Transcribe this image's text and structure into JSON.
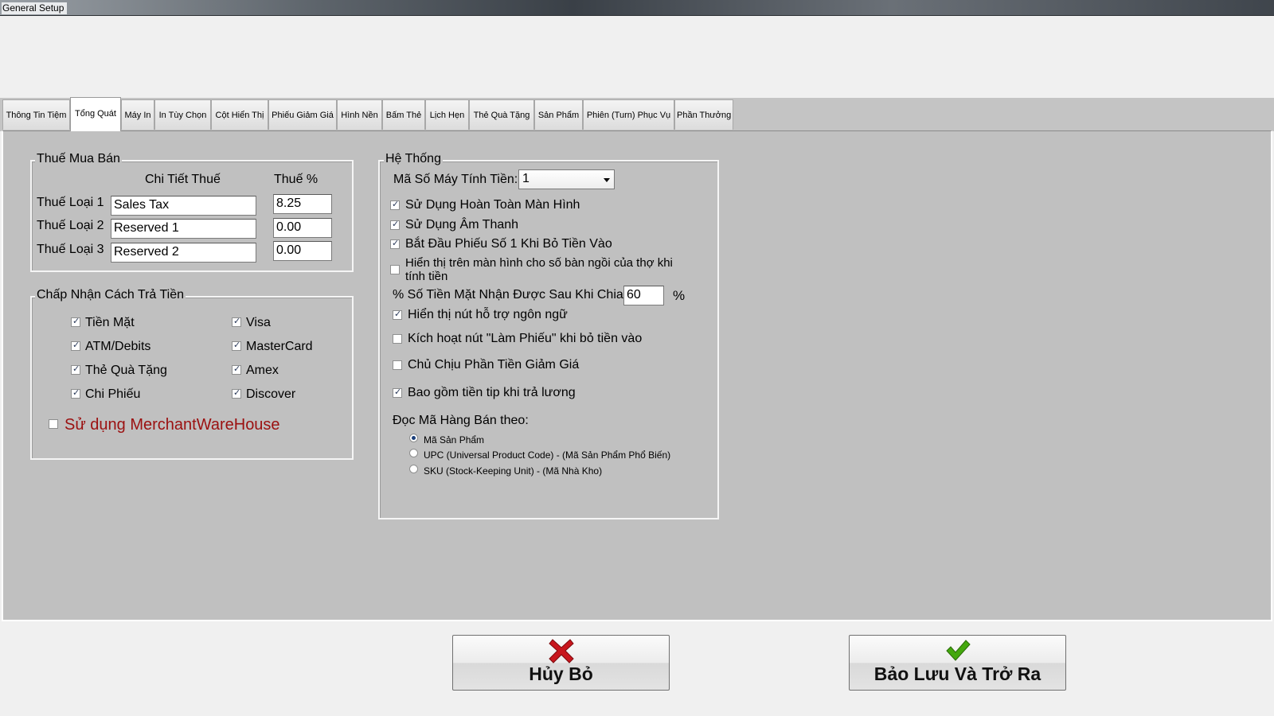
{
  "window": {
    "title": "General Setup"
  },
  "tabs": [
    {
      "label": "Thông Tin Tiệm"
    },
    {
      "label": "Tổng Quát"
    },
    {
      "label": "Máy In"
    },
    {
      "label": "In Tùy Chọn"
    },
    {
      "label": "Cột Hiển Thị"
    },
    {
      "label": "Phiếu Giảm Giá"
    },
    {
      "label": "Hình Nền"
    },
    {
      "label": "Bấm Thẻ"
    },
    {
      "label": "Lịch Hẹn"
    },
    {
      "label": "Thẻ Quà Tặng"
    },
    {
      "label": "Sản Phẩm"
    },
    {
      "label": "Phiên (Turn) Phục Vụ"
    },
    {
      "label": "Phần Thưởng"
    }
  ],
  "active_tab": "Tổng Quát",
  "tax": {
    "legend": "Thuế Mua Bán",
    "col_detail": "Chi Tiết Thuế",
    "col_rate": "Thuế %",
    "rows": [
      {
        "label": "Thuế Loại 1",
        "detail": "Sales Tax",
        "rate": "8.25"
      },
      {
        "label": "Thuế Loại 2",
        "detail": "Reserved 1",
        "rate": "0.00"
      },
      {
        "label": "Thuế Loại 3",
        "detail": "Reserved 2",
        "rate": "0.00"
      }
    ]
  },
  "payment": {
    "legend": "Chấp Nhận Cách Trả Tiền",
    "left": [
      {
        "label": "Tiền Mặt",
        "checked": true
      },
      {
        "label": "ATM/Debits",
        "checked": true
      },
      {
        "label": "Thẻ Quà Tặng",
        "checked": true
      },
      {
        "label": "Chi Phiếu",
        "checked": true
      }
    ],
    "right": [
      {
        "label": "Visa",
        "checked": true
      },
      {
        "label": "MasterCard",
        "checked": true
      },
      {
        "label": "Amex",
        "checked": true
      },
      {
        "label": "Discover",
        "checked": true
      }
    ],
    "merchant": {
      "label": "Sử dụng MerchantWareHouse",
      "checked": false,
      "color": "#9b1010"
    }
  },
  "system": {
    "legend": "Hệ Thống",
    "register_label": "Mã Số Máy Tính Tiền:",
    "register_value": "1",
    "options": [
      {
        "label": "Sử Dụng Hoàn Toàn Màn Hình",
        "checked": true
      },
      {
        "label": "Sử Dụng Âm Thanh",
        "checked": true
      },
      {
        "label": "Bắt Đầu Phiếu Số 1 Khi Bỏ Tiền Vào",
        "checked": true
      },
      {
        "label": "Hiển thị trên màn hình cho số bàn ngồi của thợ khi tính tiền",
        "checked": false
      }
    ],
    "cash_label": "% Số Tiền Mặt Nhận Được Sau Khi Chia:",
    "cash_value": "60",
    "cash_unit": "%",
    "options2": [
      {
        "label": "Hiển thị nút hỗ trợ ngôn ngữ",
        "checked": true
      },
      {
        "label": "Kích hoạt nút \"Làm Phiếu\" khi bỏ tiền vào",
        "checked": false
      },
      {
        "label": "Chủ Chịu Phần Tiền Giảm Giá",
        "checked": false
      },
      {
        "label": "Bao gồm tiền tip khi trả lương",
        "checked": true
      }
    ],
    "read_label": "Đọc Mã Hàng Bán theo:",
    "read_options": [
      {
        "label": "Mã Sản Phẩm",
        "selected": true
      },
      {
        "label": "UPC (Universal Product Code) - (Mã Sản Phẩm Phổ Biến)",
        "selected": false
      },
      {
        "label": "SKU (Stock-Keeping Unit) - (Mã Nhà Kho)",
        "selected": false
      }
    ]
  },
  "buttons": {
    "cancel": {
      "label": "Hủy Bỏ",
      "icon": "red-x-icon"
    },
    "save": {
      "label": "Bảo Lưu Và Trở Ra",
      "icon": "green-check-icon"
    }
  },
  "colors": {
    "panel": "#c0c0c0",
    "merchant_text": "#9b1010",
    "cancel_icon": "#c8161d",
    "save_icon": "#44a80e"
  }
}
